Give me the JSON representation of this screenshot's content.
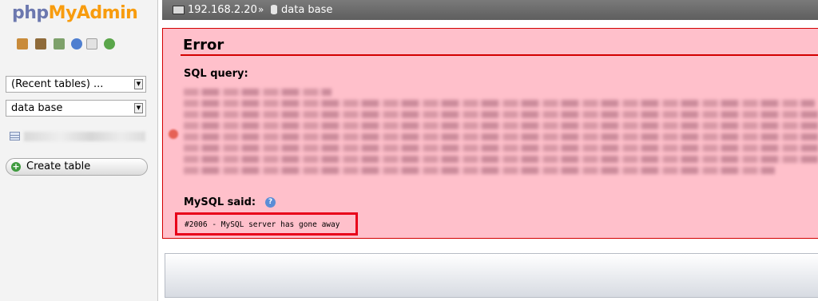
{
  "app": {
    "logo_part1": "php",
    "logo_part2": "MyAdmin"
  },
  "nav": {
    "icons": [
      "home-icon",
      "exit-icon",
      "query-window-icon",
      "docs-icon",
      "copy-icon",
      "reload-icon"
    ],
    "recent_tables": "(Recent tables) ...",
    "database_select": "data base",
    "create_table": "Create table"
  },
  "breadcrumb": {
    "server": "192.168.2.20",
    "separator": "»",
    "database": "data base"
  },
  "error": {
    "title": "Error",
    "sql_label": "SQL query:",
    "mysql_said": "MySQL said:",
    "message": "#2006 - MySQL server has gone away"
  },
  "colors": {
    "error_bg": "#ffc0cb",
    "error_border": "#d30000",
    "highlight": "#e8001a"
  }
}
